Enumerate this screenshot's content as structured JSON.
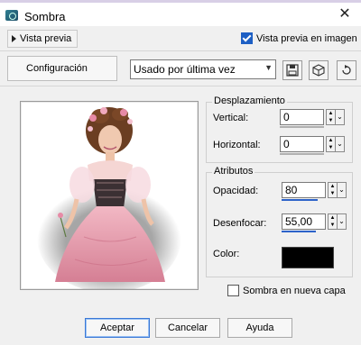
{
  "window": {
    "title": "Sombra"
  },
  "preview_toggle": {
    "label": "Vista previa"
  },
  "preview_on_image": {
    "label": "Vista previa en imagen",
    "checked": true
  },
  "config": {
    "label": "Configuración",
    "preset": "Usado por última vez"
  },
  "offset": {
    "title": "Desplazamiento",
    "vertical_label": "Vertical:",
    "vertical_value": "0",
    "horizontal_label": "Horizontal:",
    "horizontal_value": "0"
  },
  "attributes": {
    "title": "Atributos",
    "opacity_label": "Opacidad:",
    "opacity_value": "80",
    "blur_label": "Desenfocar:",
    "blur_value": "55,00",
    "color_label": "Color:",
    "color_value": "#000000"
  },
  "new_layer": {
    "label": "Sombra en nueva capa",
    "checked": false
  },
  "buttons": {
    "ok": "Aceptar",
    "cancel": "Cancelar",
    "help": "Ayuda"
  },
  "icons": [
    "app-shadow-icon",
    "close-icon",
    "save-preset-icon",
    "randomize-icon",
    "reset-icon"
  ]
}
